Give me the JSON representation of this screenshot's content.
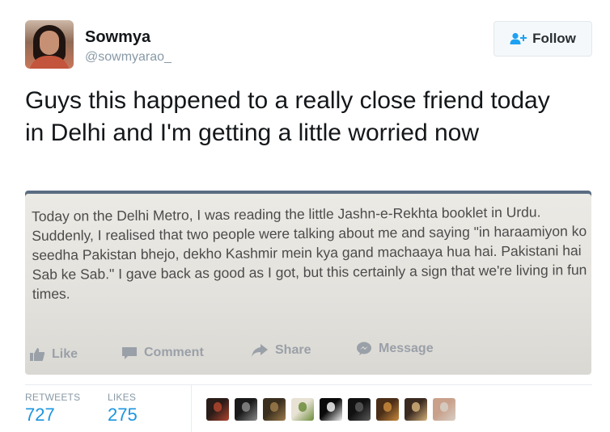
{
  "user": {
    "name": "Sowmya",
    "handle": "@sowmyarao_"
  },
  "follow_button": {
    "label": "Follow",
    "icon": "person-plus-icon"
  },
  "tweet": {
    "text": "Guys this happened to a really close friend today in Delhi and I'm getting a little worried now"
  },
  "attached_image": {
    "post_text": "Today on the Delhi Metro, I was reading the little Jashn-e-Rekhta booklet in Urdu. Suddenly, I realised that two people were talking about me and saying \"in haraamiyon ko seedha Pakistan bhejo, dekho Kashmir mein kya gand machaaya hua hai. Pakistani hai Sab ke Sab.\" I gave back as good as I got, but this certainly a sign that we're living in fun times.",
    "actions": [
      {
        "label": "Like",
        "icon": "thumbs-up-icon"
      },
      {
        "label": "Comment",
        "icon": "comment-icon"
      },
      {
        "label": "Share",
        "icon": "share-arrow-icon"
      },
      {
        "label": "Message",
        "icon": "messenger-icon"
      }
    ]
  },
  "stats": {
    "retweets_label": "RETWEETS",
    "retweets_count": "727",
    "likes_label": "LIKES",
    "likes_count": "275"
  },
  "likers": [
    {
      "name": "liker-avatar-1",
      "colors": [
        "#2a1c18",
        "#b0452e"
      ]
    },
    {
      "name": "liker-avatar-2",
      "colors": [
        "#1a1a1a",
        "#8a8a8a"
      ]
    },
    {
      "name": "liker-avatar-3",
      "colors": [
        "#3a2e1e",
        "#9c7b4a"
      ]
    },
    {
      "name": "liker-avatar-4",
      "colors": [
        "#e8e2d4",
        "#6b8c3a"
      ]
    },
    {
      "name": "liker-avatar-5",
      "colors": [
        "#0a0a0a",
        "#f2f2f2"
      ]
    },
    {
      "name": "liker-avatar-6",
      "colors": [
        "#111111",
        "#5a5a5a"
      ]
    },
    {
      "name": "liker-avatar-7",
      "colors": [
        "#4a2e18",
        "#c98a3c"
      ]
    },
    {
      "name": "liker-avatar-8",
      "colors": [
        "#3b2a20",
        "#d4b07a"
      ]
    },
    {
      "name": "liker-avatar-9",
      "colors": [
        "#c9a08a",
        "#d7cfc6"
      ]
    }
  ],
  "colors": {
    "link_blue": "#1b95e0",
    "muted_gray": "#8899a6",
    "follow_icon_blue": "#1da1f2"
  }
}
